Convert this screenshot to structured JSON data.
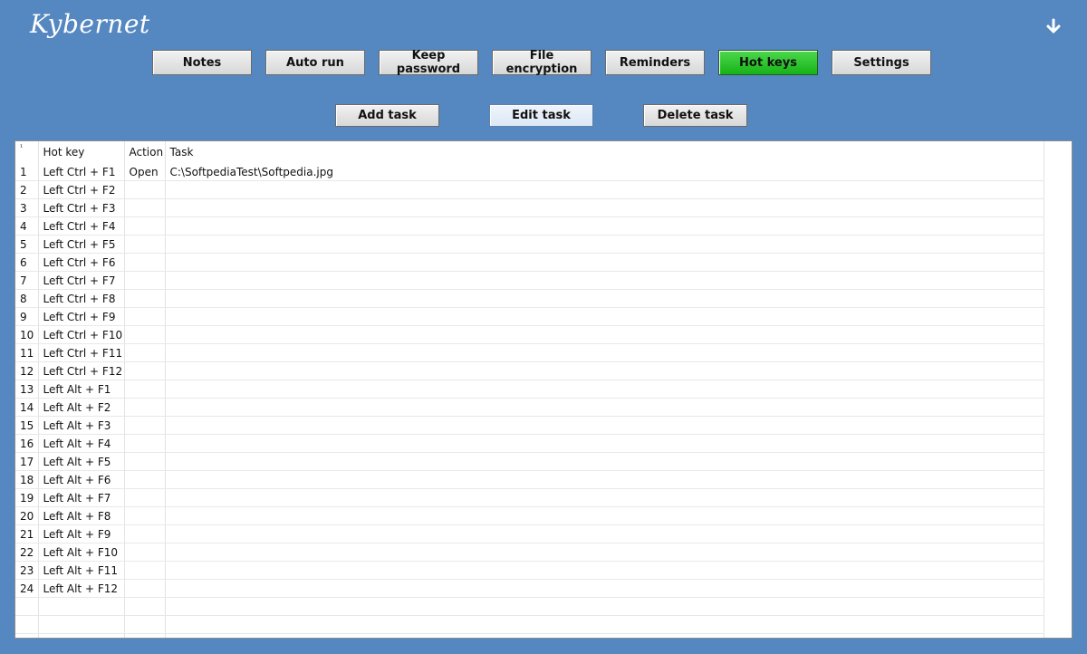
{
  "app": {
    "title": "Kybernet"
  },
  "icons": {
    "menu": "down-arrow-icon"
  },
  "colors": {
    "background": "#5587c0",
    "active_tab": "#22c022"
  },
  "nav": {
    "notes": "Notes",
    "auto_run": "Auto run",
    "keep_password": "Keep password",
    "file_encryption": "File encryption",
    "reminders": "Reminders",
    "hot_keys": "Hot keys",
    "settings": "Settings",
    "active": "hot_keys"
  },
  "actions": {
    "add_task": "Add task",
    "edit_task": "Edit task",
    "delete_task": "Delete task"
  },
  "grid": {
    "corner": "¹",
    "headers": [
      "Hot key",
      "Action",
      "Task"
    ],
    "rows": [
      {
        "n": "1",
        "hotkey": "Left Ctrl + F1",
        "action": "Open",
        "task": "C:\\SoftpediaTest\\Softpedia.jpg"
      },
      {
        "n": "2",
        "hotkey": "Left Ctrl + F2",
        "action": "",
        "task": ""
      },
      {
        "n": "3",
        "hotkey": "Left Ctrl + F3",
        "action": "",
        "task": ""
      },
      {
        "n": "4",
        "hotkey": "Left Ctrl + F4",
        "action": "",
        "task": ""
      },
      {
        "n": "5",
        "hotkey": "Left Ctrl + F5",
        "action": "",
        "task": ""
      },
      {
        "n": "6",
        "hotkey": "Left Ctrl + F6",
        "action": "",
        "task": ""
      },
      {
        "n": "7",
        "hotkey": "Left Ctrl + F7",
        "action": "",
        "task": ""
      },
      {
        "n": "8",
        "hotkey": "Left Ctrl + F8",
        "action": "",
        "task": ""
      },
      {
        "n": "9",
        "hotkey": "Left Ctrl + F9",
        "action": "",
        "task": ""
      },
      {
        "n": "10",
        "hotkey": "Left Ctrl + F10",
        "action": "",
        "task": ""
      },
      {
        "n": "11",
        "hotkey": "Left Ctrl + F11",
        "action": "",
        "task": ""
      },
      {
        "n": "12",
        "hotkey": "Left Ctrl + F12",
        "action": "",
        "task": ""
      },
      {
        "n": "13",
        "hotkey": "Left Alt + F1",
        "action": "",
        "task": ""
      },
      {
        "n": "14",
        "hotkey": "Left Alt + F2",
        "action": "",
        "task": ""
      },
      {
        "n": "15",
        "hotkey": "Left Alt + F3",
        "action": "",
        "task": ""
      },
      {
        "n": "16",
        "hotkey": "Left Alt + F4",
        "action": "",
        "task": ""
      },
      {
        "n": "17",
        "hotkey": "Left Alt + F5",
        "action": "",
        "task": ""
      },
      {
        "n": "18",
        "hotkey": "Left Alt + F6",
        "action": "",
        "task": ""
      },
      {
        "n": "19",
        "hotkey": "Left Alt + F7",
        "action": "",
        "task": ""
      },
      {
        "n": "20",
        "hotkey": "Left Alt + F8",
        "action": "",
        "task": ""
      },
      {
        "n": "21",
        "hotkey": "Left Alt + F9",
        "action": "",
        "task": ""
      },
      {
        "n": "22",
        "hotkey": "Left Alt + F10",
        "action": "",
        "task": ""
      },
      {
        "n": "23",
        "hotkey": "Left Alt + F11",
        "action": "",
        "task": ""
      },
      {
        "n": "24",
        "hotkey": "Left Alt + F12",
        "action": "",
        "task": ""
      }
    ]
  }
}
